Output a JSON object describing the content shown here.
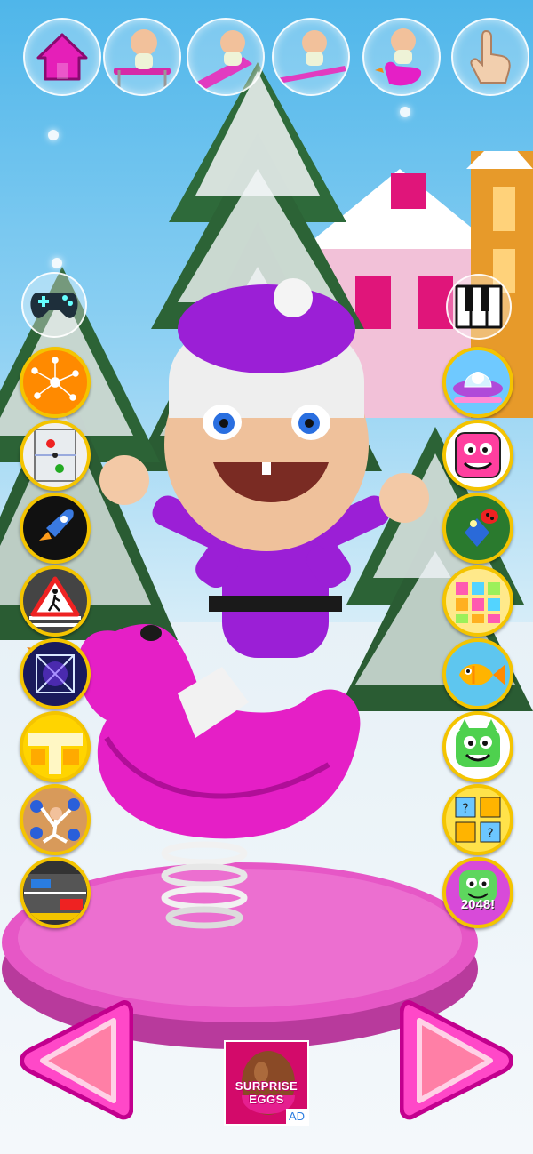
{
  "scene": {
    "sky_color": "#4fb6ea",
    "platform_color": "#e657c6",
    "duck_color": "#e51fc6",
    "outfit_color": "#9b1fd6"
  },
  "top_bar": {
    "items": [
      {
        "name": "home",
        "icon": "home-icon"
      },
      {
        "name": "baby-swing",
        "icon": "baby-on-swing-icon"
      },
      {
        "name": "baby-slide",
        "icon": "baby-on-slide-icon"
      },
      {
        "name": "baby-seesaw",
        "icon": "baby-on-seesaw-icon"
      },
      {
        "name": "baby-duck",
        "icon": "baby-on-duck-icon"
      },
      {
        "name": "touch",
        "icon": "hand-pointer-icon"
      }
    ]
  },
  "left_games": [
    {
      "name": "gamepad",
      "icon": "gamepad-icon"
    },
    {
      "name": "dots-game",
      "icon": "orange-dots-icon"
    },
    {
      "name": "air-hockey",
      "icon": "air-hockey-icon"
    },
    {
      "name": "rocket",
      "icon": "rocket-icon"
    },
    {
      "name": "crosswalk",
      "icon": "pedestrian-crossing-icon"
    },
    {
      "name": "lines",
      "icon": "neon-lines-icon"
    },
    {
      "name": "blocks",
      "icon": "yellow-blocks-icon"
    },
    {
      "name": "acrobat",
      "icon": "acrobat-icon"
    },
    {
      "name": "road",
      "icon": "road-traffic-icon"
    }
  ],
  "right_games": [
    {
      "name": "piano",
      "icon": "piano-icon"
    },
    {
      "name": "ufo",
      "icon": "ufo-icon"
    },
    {
      "name": "pink-monster",
      "icon": "pink-monster-icon"
    },
    {
      "name": "ladybug",
      "icon": "ladybug-icon"
    },
    {
      "name": "candy-match",
      "icon": "candy-match-icon"
    },
    {
      "name": "fish",
      "icon": "fish-icon"
    },
    {
      "name": "green-monster",
      "icon": "green-monster-icon"
    },
    {
      "name": "memory",
      "icon": "memory-cards-icon"
    },
    {
      "name": "2048",
      "icon": "2048-monster-icon",
      "label": "2048!"
    }
  ],
  "navigation": {
    "prev_icon": "left-arrow-icon",
    "next_icon": "right-arrow-icon"
  },
  "ad": {
    "title": "SURPRISE EGGS",
    "tag": "AD"
  }
}
